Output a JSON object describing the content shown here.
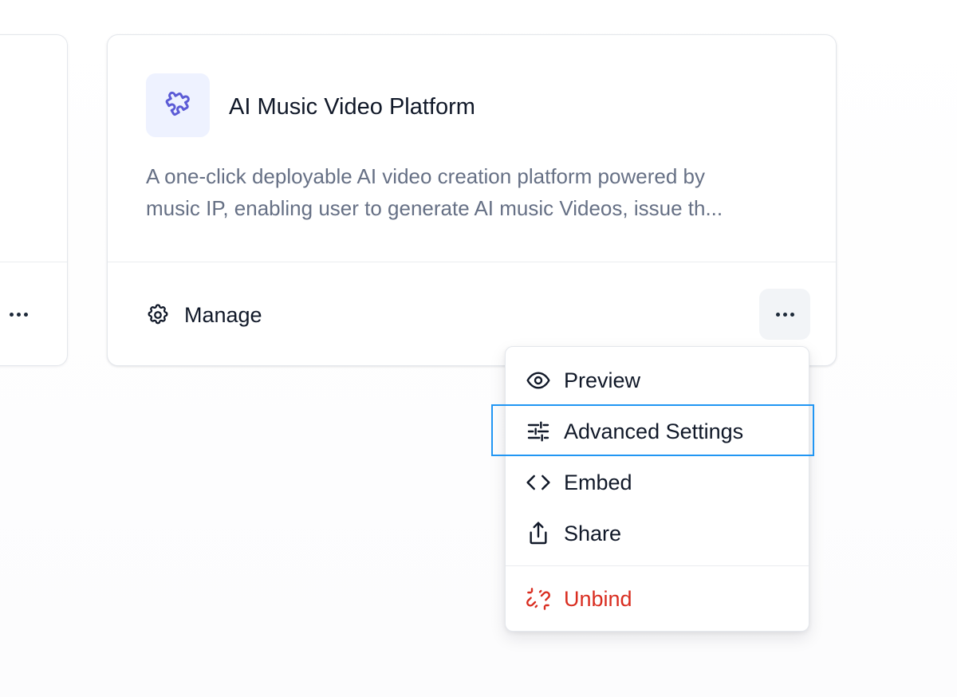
{
  "app_card": {
    "title": "AI Music Video Platform",
    "description_line1": "A one-click deployable AI video creation platform powered by",
    "description_line2": "music IP, enabling user to generate AI music Videos, issue th...",
    "icon": "puzzle-piece-icon",
    "manage_label": "Manage",
    "manage_icon": "gear-icon",
    "more_icon": "more-horizontal-icon"
  },
  "dropdown_menu": {
    "items": [
      {
        "label": "Preview",
        "icon": "eye-icon"
      },
      {
        "label": "Advanced Settings",
        "icon": "sliders-icon",
        "highlighted": true
      },
      {
        "label": "Embed",
        "icon": "code-icon"
      },
      {
        "label": "Share",
        "icon": "share-icon"
      },
      {
        "label": "Unbind",
        "icon": "unlink-icon",
        "danger": true
      }
    ]
  },
  "colors": {
    "accent_icon": "#5b5bd6",
    "icon_bg": "#eef2ff",
    "danger": "#d92d20",
    "highlight_border": "#2196f3",
    "text_primary": "#101828",
    "text_secondary": "#667085"
  }
}
